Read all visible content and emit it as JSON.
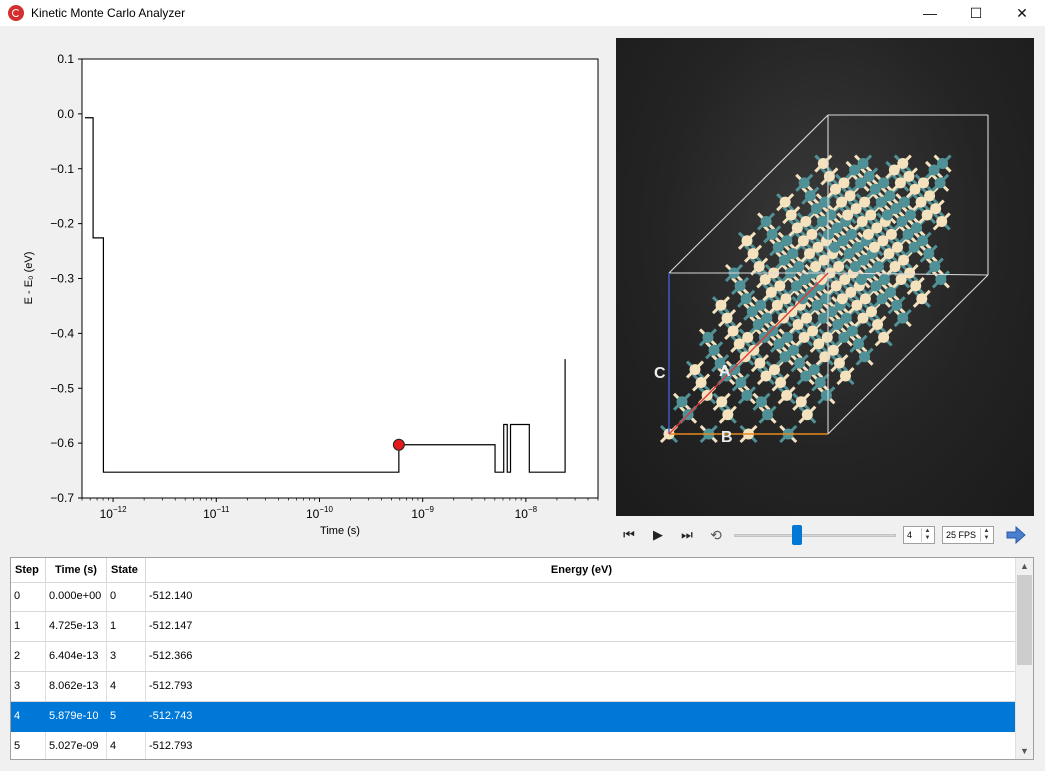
{
  "window": {
    "title": "Kinetic Monte Carlo Analyzer",
    "minimize": "—",
    "maximize": "☐",
    "close": "✕"
  },
  "chart_data": {
    "type": "line",
    "xscale": "log",
    "xlabel": "Time (s)",
    "ylabel": "E - E₀ (eV)",
    "xlim": [
      5e-13,
      5e-08
    ],
    "ylim": [
      -0.7,
      0.1
    ],
    "xticks": [
      1e-12,
      1e-11,
      1e-10,
      1e-09,
      1e-08
    ],
    "xtick_labels": [
      {
        "base": "10",
        "exp": "−12"
      },
      {
        "base": "10",
        "exp": "−11"
      },
      {
        "base": "10",
        "exp": "−10"
      },
      {
        "base": "10",
        "exp": "−9"
      },
      {
        "base": "10",
        "exp": "−8"
      }
    ],
    "yticks": [
      0.1,
      0.0,
      -0.1,
      -0.2,
      -0.3,
      -0.4,
      -0.5,
      -0.6,
      -0.7
    ],
    "ytick_labels": [
      "0.1",
      "0.0",
      "−0.1",
      "−0.2",
      "−0.3",
      "−0.4",
      "−0.5",
      "−0.6",
      "−0.7"
    ],
    "step_x": [
      5e-13,
      6.404e-13,
      8.062e-13,
      5.879e-10,
      5.027e-09,
      6.1e-09,
      6.6e-09,
      7.1e-09,
      1.08e-08,
      2.4e-08
    ],
    "step_y": [
      -0.007,
      -0.226,
      -0.653,
      -0.603,
      -0.653,
      -0.566,
      -0.653,
      -0.566,
      -0.653,
      -0.447
    ],
    "highlight": {
      "x": 5.879e-10,
      "y": -0.603,
      "color": "#e31a1c"
    },
    "grid": false,
    "line_color": "#000000"
  },
  "player": {
    "first": "⏮",
    "play": "▶",
    "last": "⏭",
    "loop": "⟲",
    "frame": "4",
    "fps": "25 FPS",
    "frame_fraction": 0.39,
    "accent": "#0078d7"
  },
  "viewer": {
    "axis_a": "A",
    "axis_b": "B",
    "axis_c": "C",
    "atom_colors": {
      "light": "#f4e2bf",
      "dark": "#4f9196"
    }
  },
  "table": {
    "columns": [
      "Step",
      "Time (s)",
      "State",
      "Energy (eV)"
    ],
    "rows": [
      [
        "0",
        "0.000e+00",
        "0",
        "-512.140"
      ],
      [
        "1",
        "4.725e-13",
        "1",
        "-512.147"
      ],
      [
        "2",
        "6.404e-13",
        "3",
        "-512.366"
      ],
      [
        "3",
        "8.062e-13",
        "4",
        "-512.793"
      ],
      [
        "4",
        "5.879e-10",
        "5",
        "-512.743"
      ],
      [
        "5",
        "5.027e-09",
        "4",
        "-512.793"
      ]
    ],
    "selected_row": 4,
    "scroll_up": "▲",
    "scroll_down": "▼"
  }
}
